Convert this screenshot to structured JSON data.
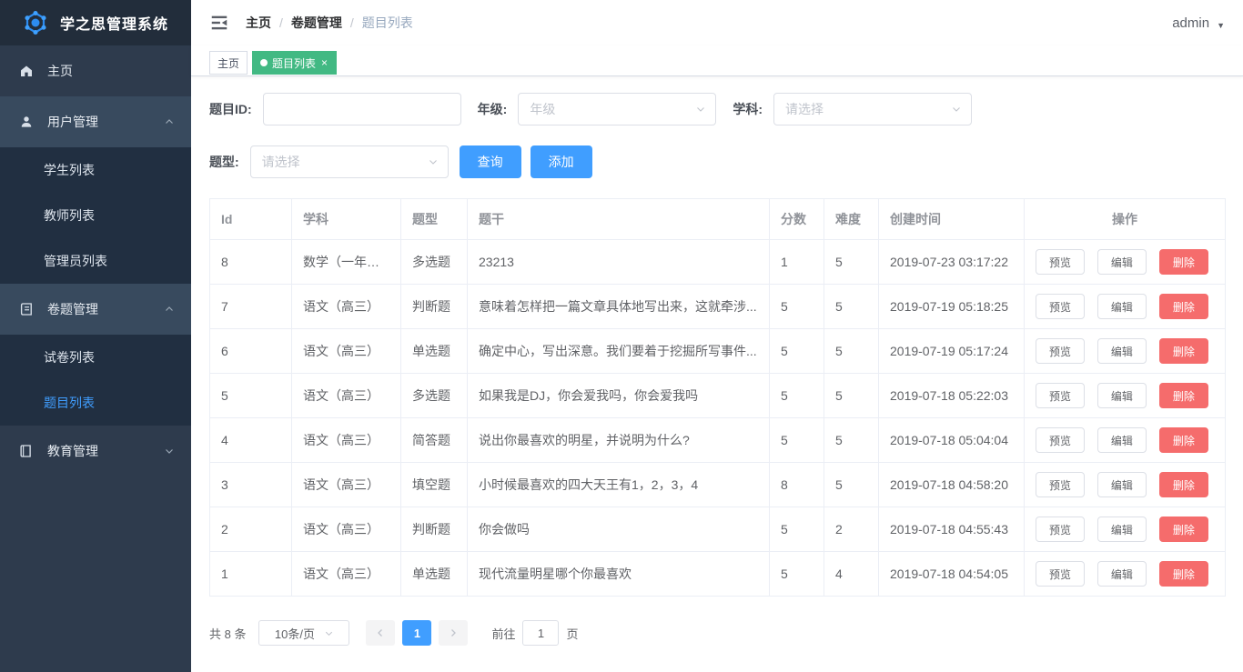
{
  "app": {
    "title": "学之思管理系统"
  },
  "topbar": {
    "breadcrumb": {
      "items": [
        "主页",
        "卷题管理",
        "题目列表"
      ],
      "separator": "/"
    },
    "user": {
      "name": "admin"
    }
  },
  "tabs": {
    "home": {
      "label": "主页"
    },
    "active": {
      "label": "题目列表",
      "close": "×"
    }
  },
  "sidebar": {
    "items": [
      {
        "label": "主页"
      },
      {
        "label": "用户管理",
        "expanded": true,
        "children": [
          {
            "label": "学生列表"
          },
          {
            "label": "教师列表"
          },
          {
            "label": "管理员列表"
          }
        ]
      },
      {
        "label": "卷题管理",
        "expanded": true,
        "children": [
          {
            "label": "试卷列表"
          },
          {
            "label": "题目列表",
            "active": true
          }
        ]
      },
      {
        "label": "教育管理",
        "expanded": false
      }
    ]
  },
  "filters": {
    "question_id": {
      "label": "题目ID:",
      "value": ""
    },
    "grade": {
      "label": "年级:",
      "placeholder": "年级"
    },
    "subject": {
      "label": "学科:",
      "placeholder": "请选择"
    },
    "question_type": {
      "label": "题型:",
      "placeholder": "请选择"
    },
    "search_button": "查询",
    "add_button": "添加"
  },
  "table": {
    "columns": [
      "Id",
      "学科",
      "题型",
      "题干",
      "分数",
      "难度",
      "创建时间",
      "操作"
    ],
    "actions": {
      "preview": "预览",
      "edit": "编辑",
      "delete": "删除"
    },
    "rows": [
      {
        "id": "8",
        "subject": "数学（一年级）",
        "qtype": "多选题",
        "stem": "23213",
        "score": "1",
        "difficulty": "5",
        "created": "2019-07-23 03:17:22"
      },
      {
        "id": "7",
        "subject": "语文（高三）",
        "qtype": "判断题",
        "stem": "意味着怎样把一篇文章具体地写出来，这就牵涉...",
        "score": "5",
        "difficulty": "5",
        "created": "2019-07-19 05:18:25"
      },
      {
        "id": "6",
        "subject": "语文（高三）",
        "qtype": "单选题",
        "stem": "确定中心，写出深意。我们要着于挖掘所写事件...",
        "score": "5",
        "difficulty": "5",
        "created": "2019-07-19 05:17:24"
      },
      {
        "id": "5",
        "subject": "语文（高三）",
        "qtype": "多选题",
        "stem": "如果我是DJ，你会爱我吗，你会爱我吗",
        "score": "5",
        "difficulty": "5",
        "created": "2019-07-18 05:22:03"
      },
      {
        "id": "4",
        "subject": "语文（高三）",
        "qtype": "简答题",
        "stem": "说出你最喜欢的明星，并说明为什么?",
        "score": "5",
        "difficulty": "5",
        "created": "2019-07-18 05:04:04"
      },
      {
        "id": "3",
        "subject": "语文（高三）",
        "qtype": "填空题",
        "stem": "小时候最喜欢的四大天王有1，2，3，4",
        "score": "8",
        "difficulty": "5",
        "created": "2019-07-18 04:58:20"
      },
      {
        "id": "2",
        "subject": "语文（高三）",
        "qtype": "判断题",
        "stem": "你会做吗",
        "score": "5",
        "difficulty": "2",
        "created": "2019-07-18 04:55:43"
      },
      {
        "id": "1",
        "subject": "语文（高三）",
        "qtype": "单选题",
        "stem": "现代流量明星哪个你最喜欢",
        "score": "5",
        "difficulty": "4",
        "created": "2019-07-18 04:54:05"
      }
    ]
  },
  "pagination": {
    "total": "共 8 条",
    "page_size": "10条/页",
    "current_page": "1",
    "goto_label": "前往",
    "goto_value": "1",
    "goto_unit": "页"
  },
  "colors": {
    "accent": "#409eff",
    "tab_active_green": "#42b983",
    "danger": "#f56c6c",
    "sidebar_bg": "#2e3b4d",
    "sidebar_submenu_bg": "#212f41"
  }
}
